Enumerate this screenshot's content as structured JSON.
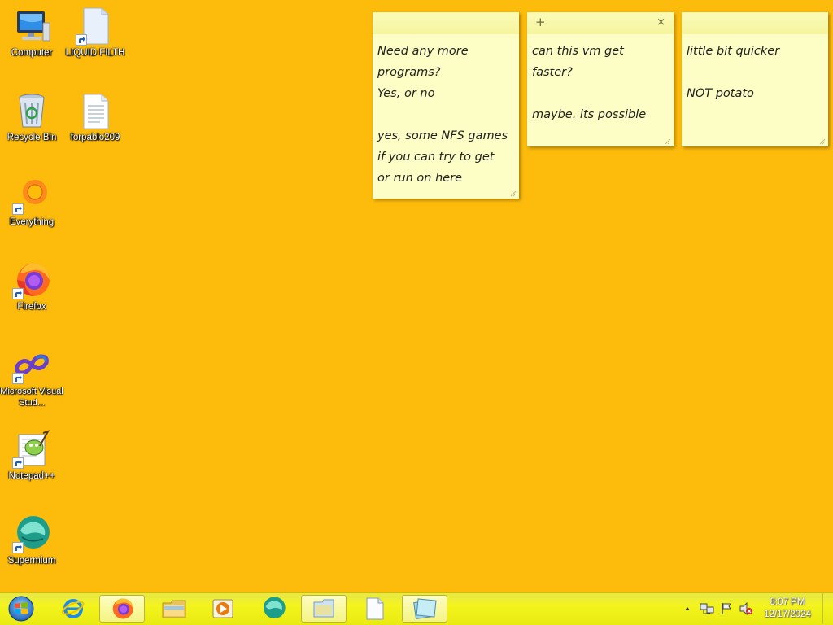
{
  "desktop": {
    "background": "#fdbb0c",
    "icons": [
      {
        "label": "Computer"
      },
      {
        "label": "LIQUID FILTH"
      },
      {
        "label": "Recycle Bin"
      },
      {
        "label": "forpablo209"
      },
      {
        "label": "Everything"
      },
      {
        "label": "Firefox"
      },
      {
        "label": "Microsoft Visual Stud..."
      },
      {
        "label": "Notepad++"
      },
      {
        "label": "Supermium"
      }
    ]
  },
  "notes": [
    {
      "text": "Need any more\nprograms?\nYes, or no\n\nyes, some NFS games\nif you can try to get\nor run on here"
    },
    {
      "add": "+",
      "close": "×",
      "text": "can this vm get\nfaster?\n\nmaybe. its possible"
    },
    {
      "text": "little bit quicker\n\nNOT potato"
    }
  ],
  "taskbar": {
    "clock_time": "8:07 PM",
    "clock_date": "12/17/2024",
    "accent": "#f2f21a"
  }
}
